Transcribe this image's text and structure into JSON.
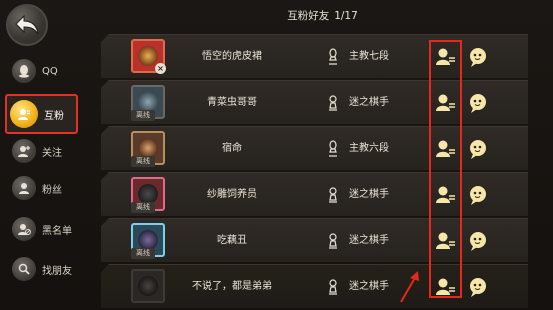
{
  "header": {
    "title": "互粉好友",
    "count": "1/17"
  },
  "sidebar": {
    "items": [
      {
        "label": "QQ",
        "icon": "qq-icon"
      },
      {
        "label": "互粉",
        "icon": "mutual-follow-icon",
        "active": true
      },
      {
        "label": "关注",
        "icon": "follow-icon"
      },
      {
        "label": "粉丝",
        "icon": "fans-icon"
      },
      {
        "label": "黑名单",
        "icon": "blacklist-icon"
      },
      {
        "label": "找朋友",
        "icon": "search-icon"
      }
    ]
  },
  "friends": [
    {
      "name": "悟空的虎皮裙",
      "rank": "主教七段",
      "status": "",
      "piece": "bishop"
    },
    {
      "name": "青菜虫哥哥",
      "rank": "迷之棋手",
      "status": "离线",
      "piece": "pawn"
    },
    {
      "name": "宿命",
      "rank": "主教六段",
      "status": "离线",
      "piece": "bishop"
    },
    {
      "name": "纱雕饲养员",
      "rank": "迷之棋手",
      "status": "离线",
      "piece": "pawn"
    },
    {
      "name": "吃藕丑",
      "rank": "迷之棋手",
      "status": "离线",
      "piece": "pawn"
    },
    {
      "name": "不说了，都是弟弟",
      "rank": "迷之棋手",
      "status": "",
      "piece": "pawn"
    }
  ],
  "colors": {
    "accent": "#f3b51c",
    "annotation": "#e5281a"
  }
}
